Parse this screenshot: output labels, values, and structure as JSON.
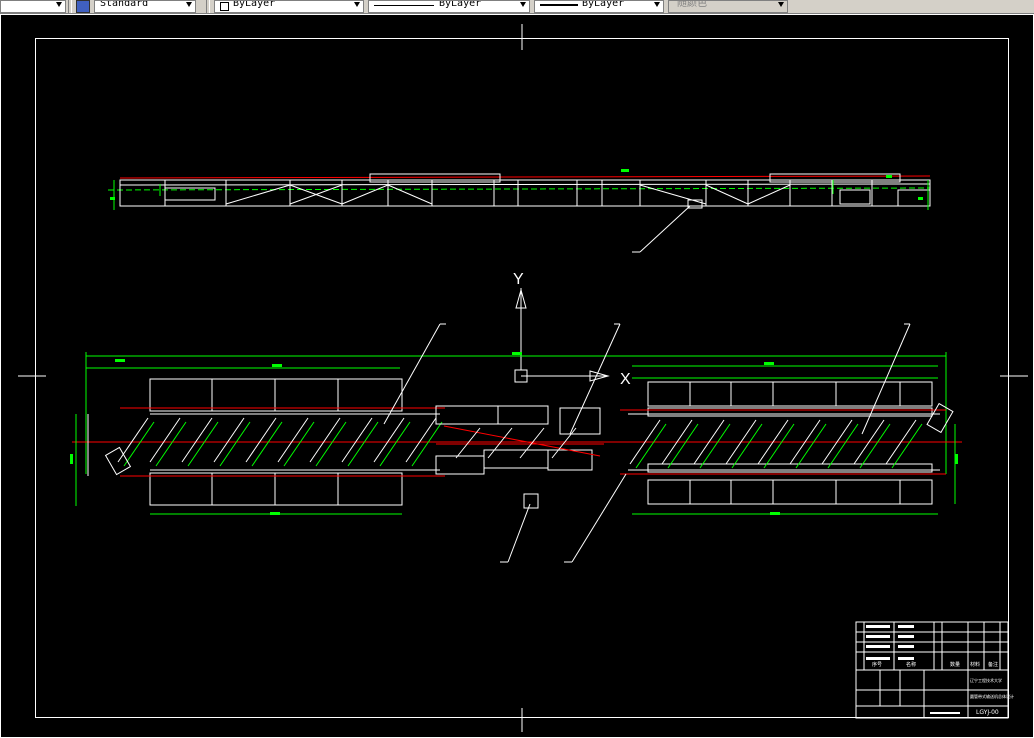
{
  "toolbar": {
    "text_style": "Standard",
    "layer": "ByLayer",
    "linetype": "ByLayer",
    "lineweight": "ByLayer",
    "plot_style": "随颜色"
  },
  "drawing": {
    "axis_y_label": "Y",
    "axis_x_label": "X",
    "title_block": {
      "company": "辽宁工程技术大学",
      "drawing_title": "圆管带式输送机总体设计",
      "drawing_no": "LGYJ-00",
      "col_seq": "序号",
      "col_name": "名称",
      "col_qty": "数量",
      "col_material": "材料",
      "col_note": "备注"
    }
  },
  "colors": {
    "background": "#000000",
    "lines": "#ffffff",
    "dimensions": "#00ff00",
    "centerlines": "#ff0000"
  }
}
